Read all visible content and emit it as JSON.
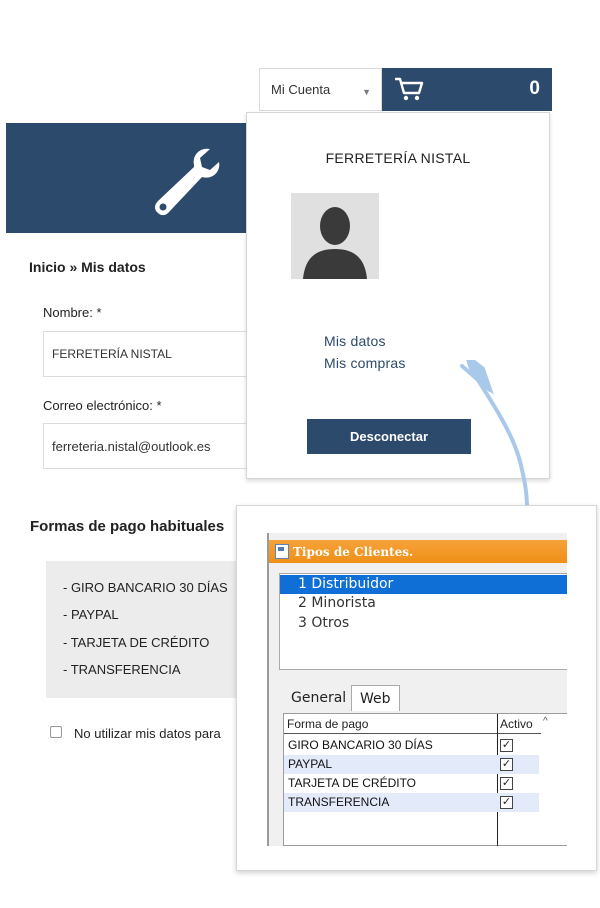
{
  "header": {
    "account_label": "Mi Cuenta",
    "cart_count": "0"
  },
  "form": {
    "breadcrumb": "Inicio » Mis datos",
    "name_label": "Nombre: *",
    "name_value": "FERRETERÍA NISTAL",
    "email_label": "Correo electrónico: *",
    "email_value": "ferreteria.nistal@outlook.es",
    "payments_title": "Formas de pago habituales",
    "payments": [
      "- GIRO BANCARIO 30 DÍAS",
      "- PAYPAL",
      "- TARJETA DE CRÉDITO",
      "- TRANSFERENCIA"
    ],
    "opt_out_label": "No utilizar mis datos para"
  },
  "dropdown": {
    "name": "FERRETERÍA NISTAL",
    "links": [
      "Mis datos",
      "Mis compras"
    ],
    "logout": "Desconectar"
  },
  "app": {
    "title": "Tipos de Clientes.",
    "client_types": [
      "1 Distribuidor",
      "2 Minorista",
      "3 Otros"
    ],
    "selected_index": 0,
    "tabs": [
      "General",
      "Web"
    ],
    "active_tab": "Web",
    "columns": [
      "Forma de pago",
      "Activo"
    ],
    "rows": [
      {
        "forma": "GIRO BANCARIO 30 DÍAS",
        "activo": true
      },
      {
        "forma": "PAYPAL",
        "activo": true
      },
      {
        "forma": "TARJETA DE CRÉDITO",
        "activo": true
      },
      {
        "forma": "TRANSFERENCIA",
        "activo": true
      }
    ]
  },
  "colors": {
    "brand_navy": "#2c4a6b",
    "app_title_orange": "#ef8f17",
    "selection_blue": "#0f6fd6",
    "arrow_blue": "#a9c9ea"
  },
  "icons": [
    "cart-icon",
    "wrench-icon",
    "user-silhouette-icon",
    "chevron-down-icon",
    "app-window-icon",
    "checkbox-icon",
    "scroll-up-icon"
  ]
}
